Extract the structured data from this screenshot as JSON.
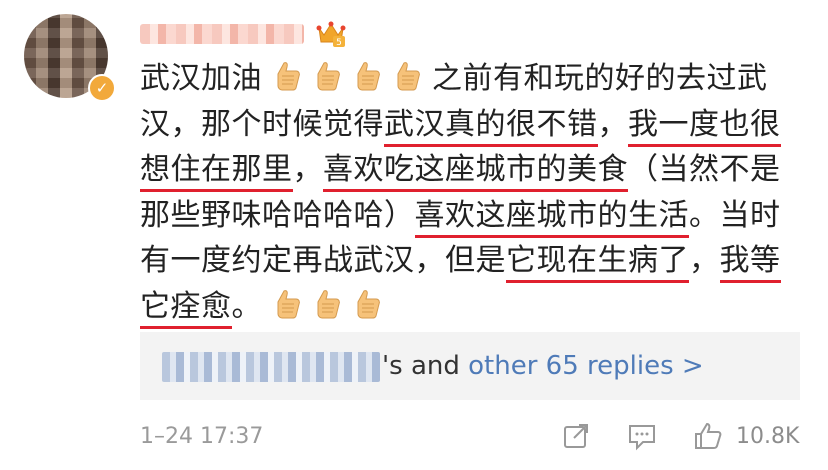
{
  "comment": {
    "lines": [
      {
        "segments": [
          {
            "text": "武汉加油",
            "hl": false
          }
        ],
        "thumbs_after": 4,
        "trailing": "之前有和玩的好的去过武"
      },
      {
        "segments": [
          {
            "text": "汉，那个时候觉得",
            "hl": false
          },
          {
            "text": "武汉真的很不错",
            "hl": true
          },
          {
            "text": "，",
            "hl": false
          },
          {
            "text": "我一度也很",
            "hl": true
          }
        ]
      },
      {
        "segments": [
          {
            "text": "想住在那里",
            "hl": true
          },
          {
            "text": "，",
            "hl": false
          },
          {
            "text": "喜欢吃这座城市的美食",
            "hl": true
          },
          {
            "text": "（当然不是",
            "hl": false
          }
        ]
      },
      {
        "segments": [
          {
            "text": "那些野味哈哈哈哈）",
            "hl": false
          },
          {
            "text": "喜欢这座城市的生活",
            "hl": true
          },
          {
            "text": "。当时",
            "hl": false
          }
        ]
      },
      {
        "segments": [
          {
            "text": "有一度约定再战武汉，但是",
            "hl": false
          },
          {
            "text": "它现在生病了",
            "hl": true
          },
          {
            "text": "，",
            "hl": false
          },
          {
            "text": "我等",
            "hl": true
          }
        ]
      },
      {
        "segments": [
          {
            "text": "它痊愈",
            "hl": true
          },
          {
            "text": "。",
            "hl": false
          }
        ],
        "thumbs_after": 3
      }
    ]
  },
  "user": {
    "verified_badge": "✓",
    "avatar_icon": "avatar",
    "crown_icon": "crown-icon"
  },
  "replies": {
    "suffix": "'s and ",
    "link": "other 65 replies >"
  },
  "footer": {
    "timestamp": "1–24 17:37",
    "like_count": "10.8K"
  },
  "colors": {
    "highlight": "#e0202e",
    "link": "#4f7bb8",
    "muted": "#9a9a9a"
  }
}
